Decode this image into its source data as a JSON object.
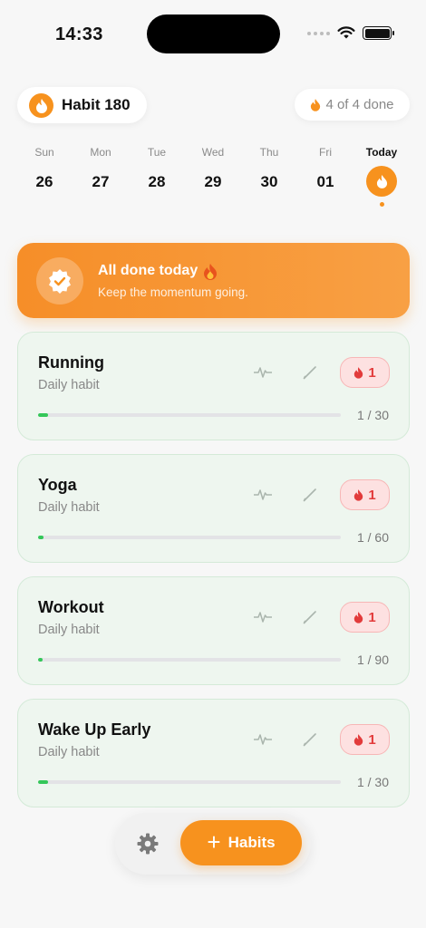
{
  "status_bar": {
    "time": "14:33"
  },
  "header": {
    "app_name": "Habit 180",
    "done_status": "4 of 4 done"
  },
  "week": [
    {
      "name": "Sun",
      "num": "26",
      "today": false
    },
    {
      "name": "Mon",
      "num": "27",
      "today": false
    },
    {
      "name": "Tue",
      "num": "28",
      "today": false
    },
    {
      "name": "Wed",
      "num": "29",
      "today": false
    },
    {
      "name": "Thu",
      "num": "30",
      "today": false
    },
    {
      "name": "Fri",
      "num": "01",
      "today": false
    },
    {
      "name": "Today",
      "num": "",
      "today": true
    }
  ],
  "banner": {
    "title": "All done today",
    "subtitle": "Keep the momentum going."
  },
  "habits": [
    {
      "name": "Running",
      "subtitle": "Daily habit",
      "streak": "1",
      "progress": "1 / 30",
      "fraction": 0.0333
    },
    {
      "name": "Yoga",
      "subtitle": "Daily habit",
      "streak": "1",
      "progress": "1 / 60",
      "fraction": 0.0167
    },
    {
      "name": "Workout",
      "subtitle": "Daily habit",
      "streak": "1",
      "progress": "1 / 90",
      "fraction": 0.0111
    },
    {
      "name": "Wake Up Early",
      "subtitle": "Daily habit",
      "streak": "1",
      "progress": "1 / 30",
      "fraction": 0.0333
    }
  ],
  "bottom_bar": {
    "add_label": "Habits"
  },
  "colors": {
    "accent": "#f7921e",
    "progress": "#34c759",
    "streak": "#e23b3b",
    "card_bg": "#eef6ef"
  },
  "icons": {
    "brand": "flame-icon",
    "done": "flame-icon",
    "badge": "verified-badge-icon",
    "banner_emoji": "fire-emoji",
    "pulse": "pulse-icon",
    "edit": "pencil-icon",
    "settings": "gear-icon",
    "add": "plus-icon"
  }
}
